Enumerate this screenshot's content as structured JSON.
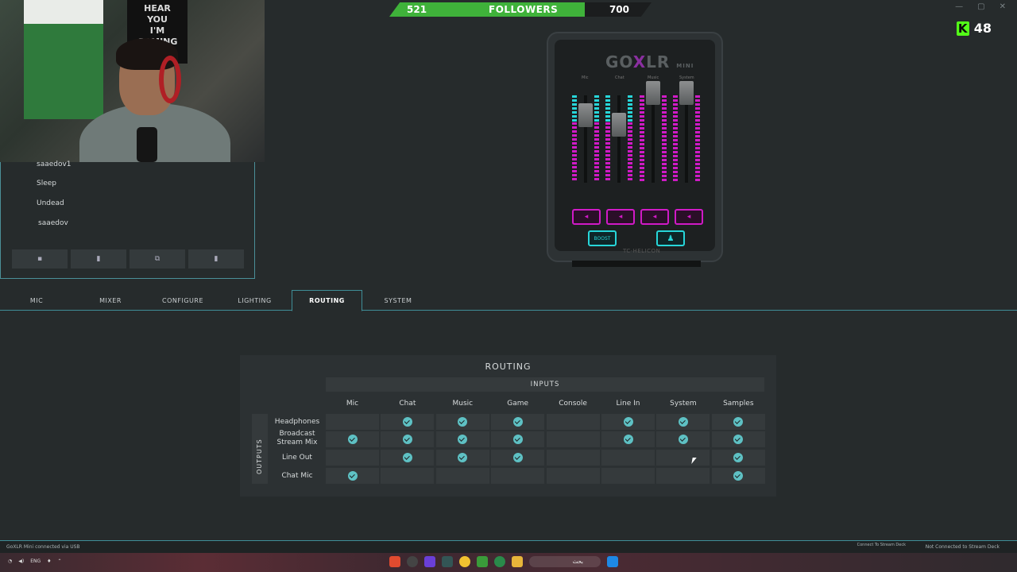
{
  "followers": {
    "current": "521",
    "label": "FOLLOWERS",
    "goal": "700",
    "progress": 0.744
  },
  "kick": {
    "count": "48"
  },
  "webcam": {
    "poster_text": "HEAR YOU I'M GAMING"
  },
  "profiles": {
    "items": [
      "saaedov1",
      "Sleep",
      "Undead",
      "saaedov"
    ]
  },
  "device": {
    "title_a": "GO",
    "title_x": "X",
    "title_b": "LR",
    "title_mini": "MINI",
    "channels": [
      "Mic",
      "Chat",
      "Music",
      "System"
    ],
    "boost_label": "BOOST",
    "brand": "TC·HELICON"
  },
  "tabs": [
    "MIC",
    "MIXER",
    "CONFIGURE",
    "LIGHTING",
    "ROUTING",
    "SYSTEM"
  ],
  "active_tab": "ROUTING",
  "routing": {
    "title": "ROUTING",
    "inputs_label": "INPUTS",
    "outputs_label": "OUTPUTS",
    "columns": [
      "Mic",
      "Chat",
      "Music",
      "Game",
      "Console",
      "Line In",
      "System",
      "Samples"
    ],
    "rows": [
      {
        "name": "Headphones",
        "enabled": [
          false,
          true,
          true,
          true,
          false,
          true,
          true,
          true
        ]
      },
      {
        "name": "Broadcast Stream Mix",
        "enabled": [
          true,
          true,
          true,
          true,
          false,
          true,
          true,
          true
        ]
      },
      {
        "name": "Line Out",
        "enabled": [
          false,
          true,
          true,
          true,
          false,
          false,
          false,
          true
        ]
      },
      {
        "name": "Chat Mic",
        "enabled": [
          true,
          false,
          false,
          false,
          false,
          false,
          false,
          true
        ]
      }
    ]
  },
  "status": {
    "left": "GoXLR Mini connected via USB",
    "middle": "Connect To Stream Deck",
    "right": "Not Connected to Stream Deck"
  },
  "taskbar": {
    "lang": "ENG",
    "search_text": "بحث"
  },
  "colors": {
    "accent": "#3f8e97",
    "check": "#5ec1c4",
    "magenta": "#d01ac6",
    "cyan": "#27d6d9",
    "follow_green": "#3fb23a"
  }
}
